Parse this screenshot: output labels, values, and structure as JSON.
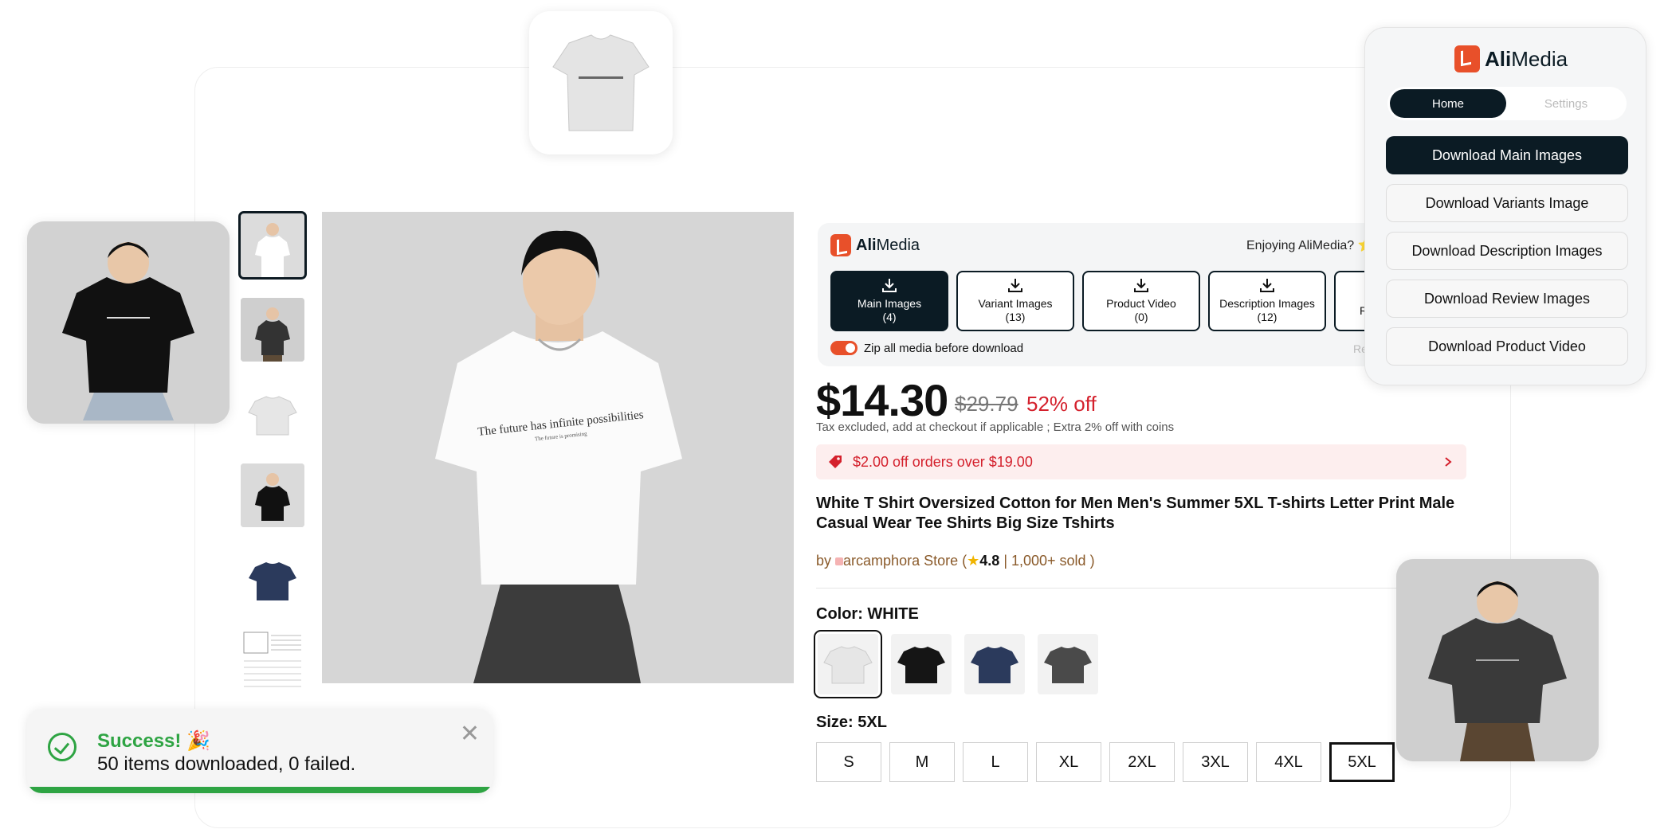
{
  "alimedia": {
    "brand_bold": "Ali",
    "brand_light": "Media",
    "enjoy_text": "Enjoying AliMedia? ⭐",
    "media_buttons": [
      {
        "label": "Main Images",
        "count": "(4)"
      },
      {
        "label": "Variant Images",
        "count": "(13)"
      },
      {
        "label": "Product Video",
        "count": "(0)"
      },
      {
        "label": "Description Images",
        "count": "(12)"
      },
      {
        "label": "Re",
        "count": ""
      }
    ],
    "zip_label": "Zip all media before download",
    "zip_on": true,
    "right_cut_text": "Re"
  },
  "popup": {
    "tabs": [
      "Home",
      "Settings"
    ],
    "active_tab": "Home",
    "buttons": [
      "Download Main Images",
      "Download Variants Image",
      "Download Description Images",
      "Download Review Images",
      "Download Product Video"
    ]
  },
  "product": {
    "price": "$14.30",
    "old_price": "$29.79",
    "discount": "52% off",
    "tax_note": "Tax excluded, add at checkout if applicable ; Extra 2% off with coins",
    "coupon": "$2.00 off orders over $19.00",
    "title": "White T Shirt Oversized Cotton for Men Men's Summer 5XL T-shirts Letter Print Male Casual Wear Tee Shirts Big Size Tshirts",
    "store_prefix": "by",
    "store_name": "arcamphora Store",
    "rating": "4.8",
    "sold": "| 1,000+ sold )",
    "store_open": "(",
    "color_label": "Color: WHITE",
    "size_label": "Size: 5XL",
    "sizes": [
      "S",
      "M",
      "L",
      "XL",
      "2XL",
      "3XL",
      "4XL",
      "5XL"
    ],
    "selected_size": "5XL",
    "tee_print": "The future has infinite possibilities",
    "tee_print_sub": "The future is promising"
  },
  "toast": {
    "title": "Success! 🎉",
    "message": "50 items downloaded, 0 failed.",
    "close": "✕"
  },
  "colors": {
    "brand": "#e8502a",
    "dark": "#0b1b24",
    "success": "#2ea443",
    "sale": "#d4202c"
  }
}
